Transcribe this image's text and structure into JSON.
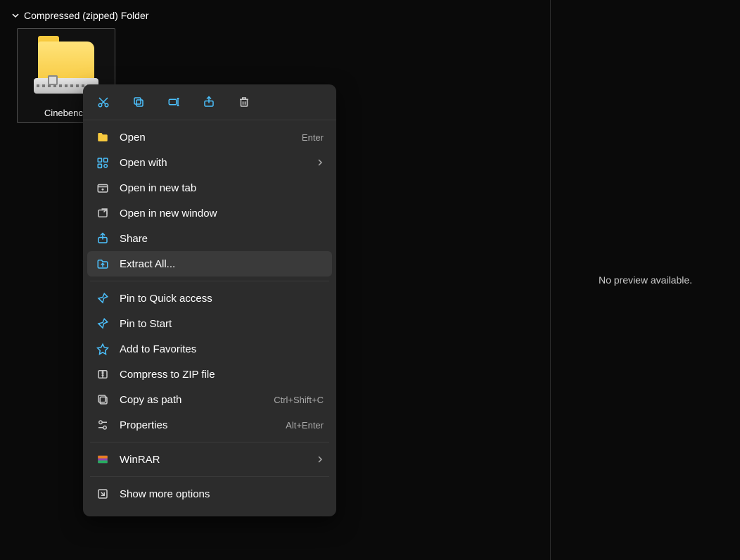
{
  "group_header": "Compressed (zipped) Folder",
  "file": {
    "name": "Cinebench"
  },
  "preview_text": "No preview available.",
  "toolbar_icons": [
    "cut",
    "copy",
    "rename",
    "share",
    "delete"
  ],
  "menu": {
    "items": [
      {
        "icon": "folder",
        "label": "Open",
        "accel": "Enter",
        "submenu": false,
        "highlight": false
      },
      {
        "icon": "openwith",
        "label": "Open with",
        "accel": "",
        "submenu": true,
        "highlight": false
      },
      {
        "icon": "newtab",
        "label": "Open in new tab",
        "accel": "",
        "submenu": false,
        "highlight": false
      },
      {
        "icon": "newwindow",
        "label": "Open in new window",
        "accel": "",
        "submenu": false,
        "highlight": false
      },
      {
        "icon": "share",
        "label": "Share",
        "accel": "",
        "submenu": false,
        "highlight": false
      },
      {
        "icon": "extract",
        "label": "Extract All...",
        "accel": "",
        "submenu": false,
        "highlight": true
      },
      {
        "sep": true
      },
      {
        "icon": "pin",
        "label": "Pin to Quick access",
        "accel": "",
        "submenu": false,
        "highlight": false
      },
      {
        "icon": "pinstart",
        "label": "Pin to Start",
        "accel": "",
        "submenu": false,
        "highlight": false
      },
      {
        "icon": "star",
        "label": "Add to Favorites",
        "accel": "",
        "submenu": false,
        "highlight": false
      },
      {
        "icon": "zip",
        "label": "Compress to ZIP file",
        "accel": "",
        "submenu": false,
        "highlight": false
      },
      {
        "icon": "copypath",
        "label": "Copy as path",
        "accel": "Ctrl+Shift+C",
        "submenu": false,
        "highlight": false
      },
      {
        "icon": "properties",
        "label": "Properties",
        "accel": "Alt+Enter",
        "submenu": false,
        "highlight": false
      },
      {
        "sep": true
      },
      {
        "icon": "winrar",
        "label": "WinRAR",
        "accel": "",
        "submenu": true,
        "highlight": false
      },
      {
        "sep": true
      },
      {
        "icon": "moreoptions",
        "label": "Show more options",
        "accel": "",
        "submenu": false,
        "highlight": false
      }
    ]
  }
}
